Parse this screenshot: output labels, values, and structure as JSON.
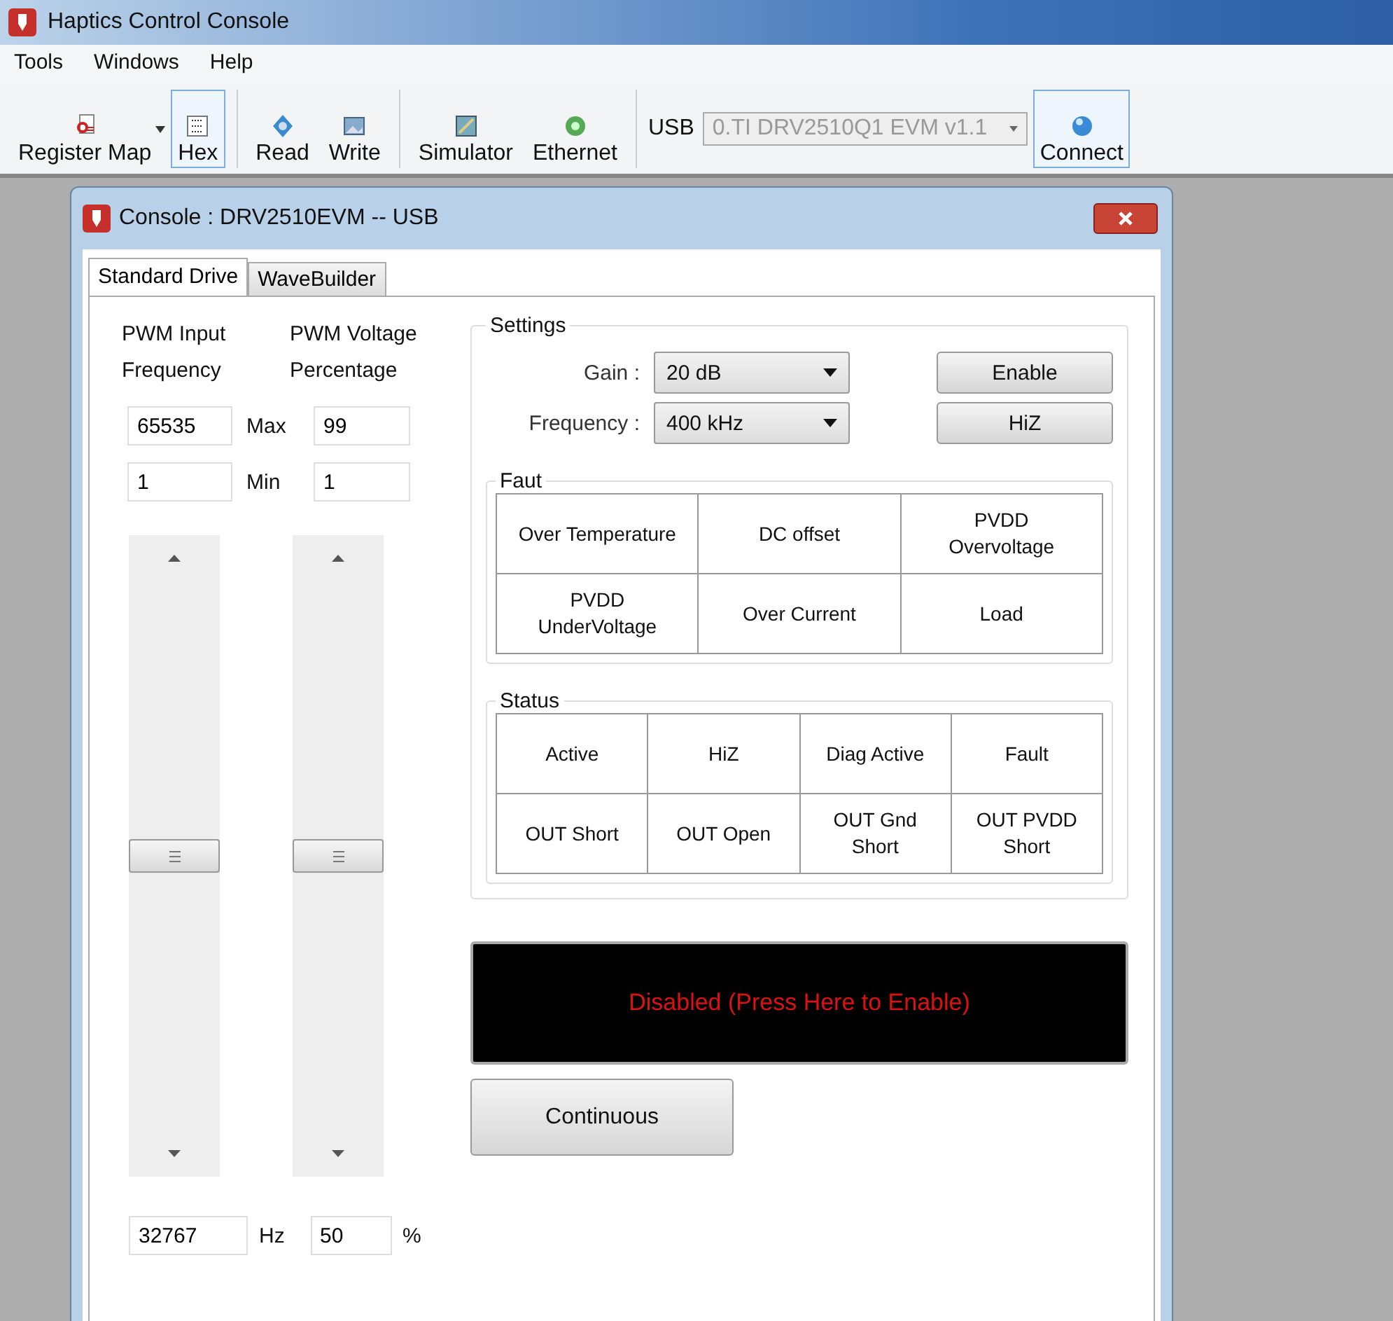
{
  "window": {
    "title": "Haptics Control Console"
  },
  "menu": [
    "Tools",
    "Windows",
    "Help"
  ],
  "toolbar": {
    "items": [
      {
        "label": "Register Map",
        "selected": false
      },
      {
        "label": "Hex",
        "selected": true
      },
      {
        "label": "Read",
        "selected": false
      },
      {
        "label": "Write",
        "selected": false
      },
      {
        "label": "Simulator",
        "selected": false
      },
      {
        "label": "Ethernet",
        "selected": false
      }
    ],
    "usb_label": "USB",
    "device": {
      "value": "0.TI DRV2510Q1 EVM v1.1",
      "disabled": true
    },
    "connect": "Connect"
  },
  "console": {
    "title": "Console : DRV2510EVM -- USB",
    "tabs": [
      {
        "label": "Standard Drive",
        "selected": true
      },
      {
        "label": "WaveBuilder",
        "selected": false
      }
    ],
    "pwm": {
      "headers": [
        "PWM Input Frequency",
        "PWM Voltage Percentage"
      ],
      "max": {
        "label": "Max",
        "values": [
          "65535",
          "99"
        ]
      },
      "min": {
        "label": "Min",
        "values": [
          "1",
          "1"
        ]
      },
      "sliders": [
        {
          "level": 0.5
        },
        {
          "level": 0.5
        }
      ],
      "readouts": [
        {
          "value": "32767",
          "unit": "Hz"
        },
        {
          "value": "50",
          "unit": "%"
        }
      ]
    },
    "settings": {
      "title": "Settings",
      "gain": {
        "label": "Gain :",
        "value": "20 dB"
      },
      "frequency": {
        "label": "Frequency :",
        "value": "400 kHz"
      },
      "buttons": [
        "Enable",
        "HiZ"
      ]
    },
    "fault": {
      "title": "Faut",
      "cells": [
        "Over Temperature",
        "DC offset",
        "PVDD Overvoltage",
        "PVDD UnderVoltage",
        "Over Current",
        "Load"
      ]
    },
    "status": {
      "title": "Status",
      "cells": [
        "Active",
        "HiZ",
        "Diag Active",
        "Fault",
        "OUT Short",
        "OUT Open",
        "OUT Gnd Short",
        "OUT PVDD Short"
      ]
    },
    "display": "Disabled (Press Here to Enable)",
    "mode_button": "Continuous"
  }
}
